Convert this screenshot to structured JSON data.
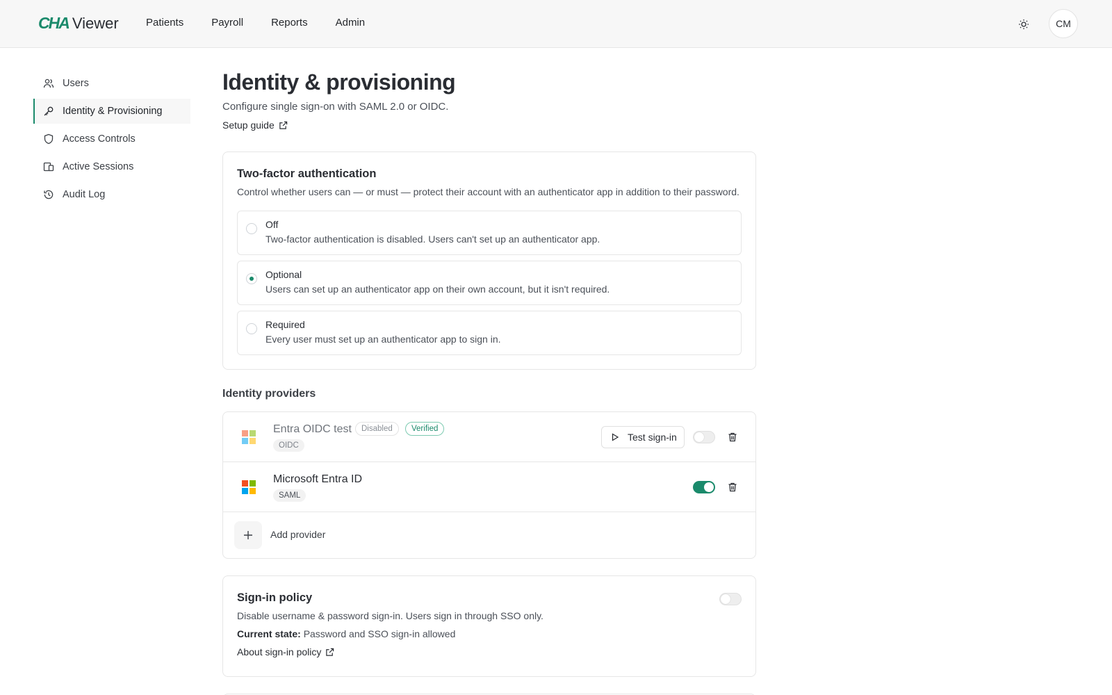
{
  "app": {
    "logo_mark": "CHA",
    "logo_text": "Viewer"
  },
  "nav": {
    "items": [
      "Patients",
      "Payroll",
      "Reports",
      "Admin"
    ]
  },
  "user": {
    "initials": "CM"
  },
  "sidebar": {
    "items": [
      {
        "label": "Users",
        "icon": "users-icon"
      },
      {
        "label": "Identity & Provisioning",
        "icon": "key-icon",
        "active": true
      },
      {
        "label": "Access Controls",
        "icon": "shield-icon"
      },
      {
        "label": "Active Sessions",
        "icon": "devices-icon"
      },
      {
        "label": "Audit Log",
        "icon": "history-icon"
      }
    ]
  },
  "page": {
    "title": "Identity & provisioning",
    "subtitle": "Configure single sign-on with SAML 2.0 or OIDC.",
    "guide_link": "Setup guide"
  },
  "two_factor": {
    "title": "Two-factor authentication",
    "description": "Control whether users can — or must — protect their account with an authenticator app in addition to their password.",
    "selected": "Optional",
    "options": [
      {
        "label": "Off",
        "description": "Two-factor authentication is disabled. Users can't set up an authenticator app."
      },
      {
        "label": "Optional",
        "description": "Users can set up an authenticator app on their own account, but it isn't required."
      },
      {
        "label": "Required",
        "description": "Every user must set up an authenticator app to sign in."
      }
    ]
  },
  "identity_providers": {
    "heading": "Identity providers",
    "providers": [
      {
        "name": "Entra OIDC test",
        "status_badge": "Disabled",
        "verified_badge": "Verified",
        "protocol": "OIDC",
        "test_button": "Test sign-in",
        "enabled": false
      },
      {
        "name": "Microsoft Entra ID",
        "protocol": "SAML",
        "enabled": true
      }
    ],
    "add_label": "Add provider"
  },
  "sign_in_policy": {
    "title": "Sign-in policy",
    "description": "Disable username & password sign-in. Users sign in through SSO only.",
    "state_label": "Current state:",
    "state_value": "Password and SSO sign-in allowed",
    "link": "About sign-in policy",
    "enabled": false
  },
  "colors": {
    "accent": "#1a8a6b",
    "ms_red": "#f25022",
    "ms_green": "#7fba00",
    "ms_blue": "#00a4ef",
    "ms_yellow": "#ffb900"
  }
}
